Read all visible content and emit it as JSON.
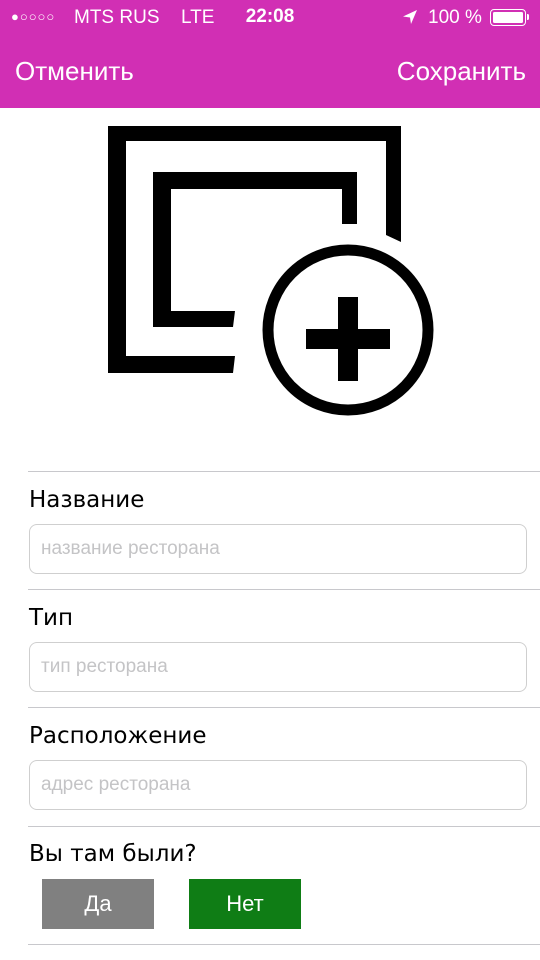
{
  "status_bar": {
    "signal": "●○○○○",
    "carrier": "MTS RUS",
    "network": "LTE",
    "time": "22:08",
    "battery": "100 %",
    "location_icon": "location-arrow-icon",
    "battery_icon": "battery-full-icon"
  },
  "nav": {
    "cancel_label": "Отменить",
    "save_label": "Сохранить"
  },
  "photo": {
    "icon": "add-photo-icon"
  },
  "form": {
    "name": {
      "label": "Название",
      "value": "",
      "placeholder": "название ресторана"
    },
    "type": {
      "label": "Тип",
      "value": "",
      "placeholder": "тип ресторана"
    },
    "location": {
      "label": "Расположение",
      "value": "",
      "placeholder": "адрес ресторана"
    },
    "visited": {
      "label": "Вы там были?",
      "yes_label": "Да",
      "no_label": "Нет",
      "selected": "no"
    }
  },
  "colors": {
    "accent": "#d12fb4",
    "yes_button": "#808080",
    "no_button": "#0f7d15"
  }
}
